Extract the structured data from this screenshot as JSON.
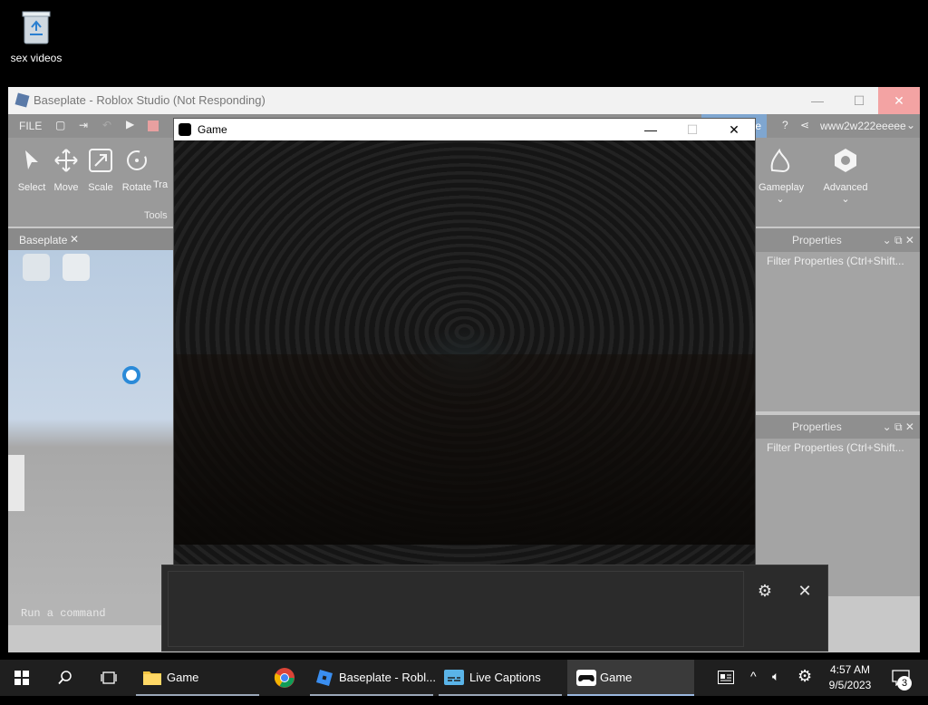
{
  "desktop": {
    "recycle_label": "sex videos"
  },
  "studio": {
    "title": "Baseplate - Roblox Studio (Not Responding)",
    "menu_file": "FILE",
    "publish_fragment": "ate",
    "username": "www2w222eeeee",
    "tools": [
      {
        "label": "Select",
        "icon": "cursor-icon"
      },
      {
        "label": "Move",
        "icon": "move-icon"
      },
      {
        "label": "Scale",
        "icon": "scale-icon"
      },
      {
        "label": "Rotate",
        "icon": "rotate-icon"
      },
      {
        "label": "Tra",
        "icon": "transform-icon"
      }
    ],
    "tools_group_label": "Tools",
    "gameplay_label": "Gameplay",
    "advanced_label": "Advanced",
    "tab_label": "Baseplate",
    "properties_title_1": "Properties",
    "properties_filter_1": "Filter Properties (Ctrl+Shift...",
    "properties_title_2": "Properties",
    "properties_filter_2": "Filter Properties (Ctrl+Shift...",
    "command_placeholder": "Run a command"
  },
  "game": {
    "title": "Game"
  },
  "taskbar": {
    "items": [
      {
        "label": "Game",
        "icon": "folder-icon"
      },
      {
        "label": "",
        "icon": "chrome-icon"
      },
      {
        "label": "Baseplate - Robl...",
        "icon": "roblox-studio-icon"
      },
      {
        "label": "Live Captions",
        "icon": "live-captions-icon"
      },
      {
        "label": "Game",
        "icon": "game-controller-icon"
      }
    ],
    "time": "4:57 AM",
    "date": "9/5/2023",
    "notification_count": "3"
  }
}
